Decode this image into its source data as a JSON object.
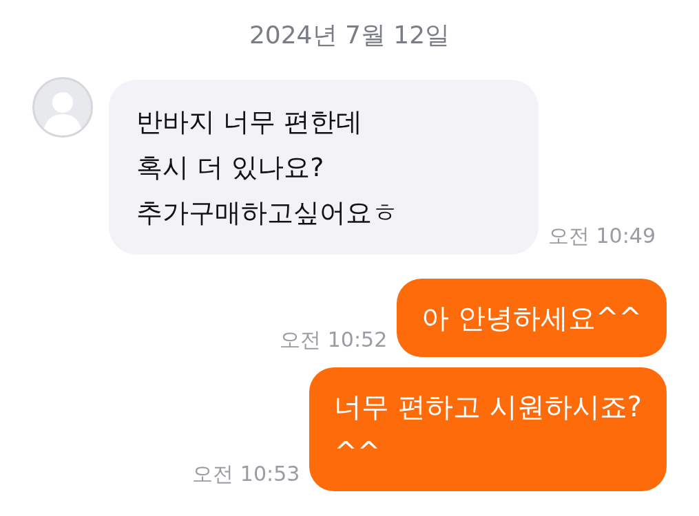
{
  "date": "2024년 7월 12일",
  "messages": [
    {
      "kind": "incoming",
      "text": "반바지 너무 편한데\n혹시 더 있나요?\n추가구매하고싶어요ㅎ",
      "time": "오전 10:49"
    },
    {
      "kind": "outgoing",
      "text": "아 안녕하세요^^",
      "time": "오전 10:52"
    },
    {
      "kind": "outgoing",
      "text": "너무 편하고 시원하시죠?\n^^",
      "time": "오전 10:53"
    }
  ]
}
